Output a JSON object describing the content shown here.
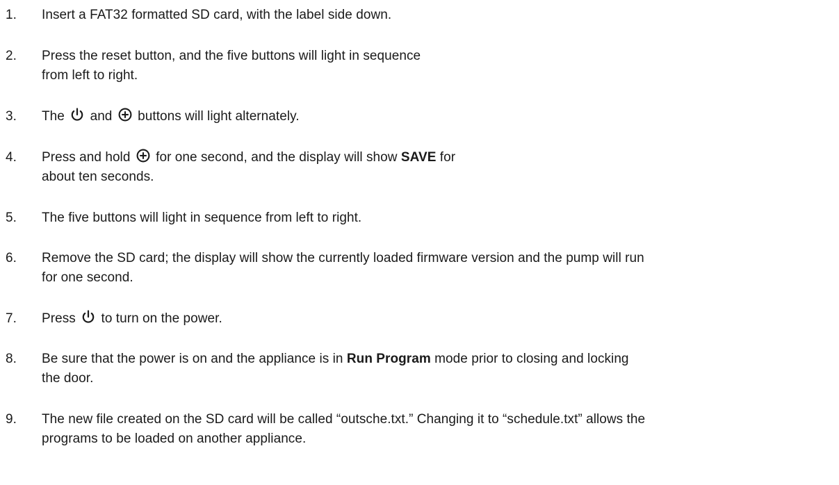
{
  "steps": [
    {
      "num": "1.",
      "lines": [
        [
          "Insert a FAT32 formatted SD card, with the label side down."
        ]
      ]
    },
    {
      "num": "2.",
      "lines": [
        [
          "Press the reset button, and the five buttons will light in sequence"
        ],
        [
          "from left to right."
        ]
      ]
    },
    {
      "num": "3.",
      "a": "The",
      "b": "and",
      "c": "buttons will light alternately."
    },
    {
      "num": "4.",
      "a": "Press and hold",
      "b": "for one second, and the display will show",
      "bold": "SAVE",
      "c": "for",
      "d": "about ten seconds."
    },
    {
      "num": "5.",
      "lines": [
        [
          "The five buttons will light in sequence from left to right."
        ]
      ]
    },
    {
      "num": "6.",
      "lines": [
        [
          "Remove the SD card; the display will show the currently loaded firmware version and the pump will run"
        ],
        [
          "for one second."
        ]
      ]
    },
    {
      "num": "7.",
      "a": "Press",
      "b": "to turn on the power."
    },
    {
      "num": "8.",
      "a": "Be sure that the power is on and the appliance is in",
      "bold": "Run Program",
      "b": "mode prior to closing and locking",
      "c": "the door."
    },
    {
      "num": "9.",
      "lines": [
        [
          "The new file created on the SD card will be called “outsche.txt.” Changing it to “schedule.txt” allows the"
        ],
        [
          "programs to be loaded on another appliance."
        ]
      ]
    }
  ],
  "icons": {
    "power": "power-icon",
    "plus": "circled-plus-icon"
  }
}
